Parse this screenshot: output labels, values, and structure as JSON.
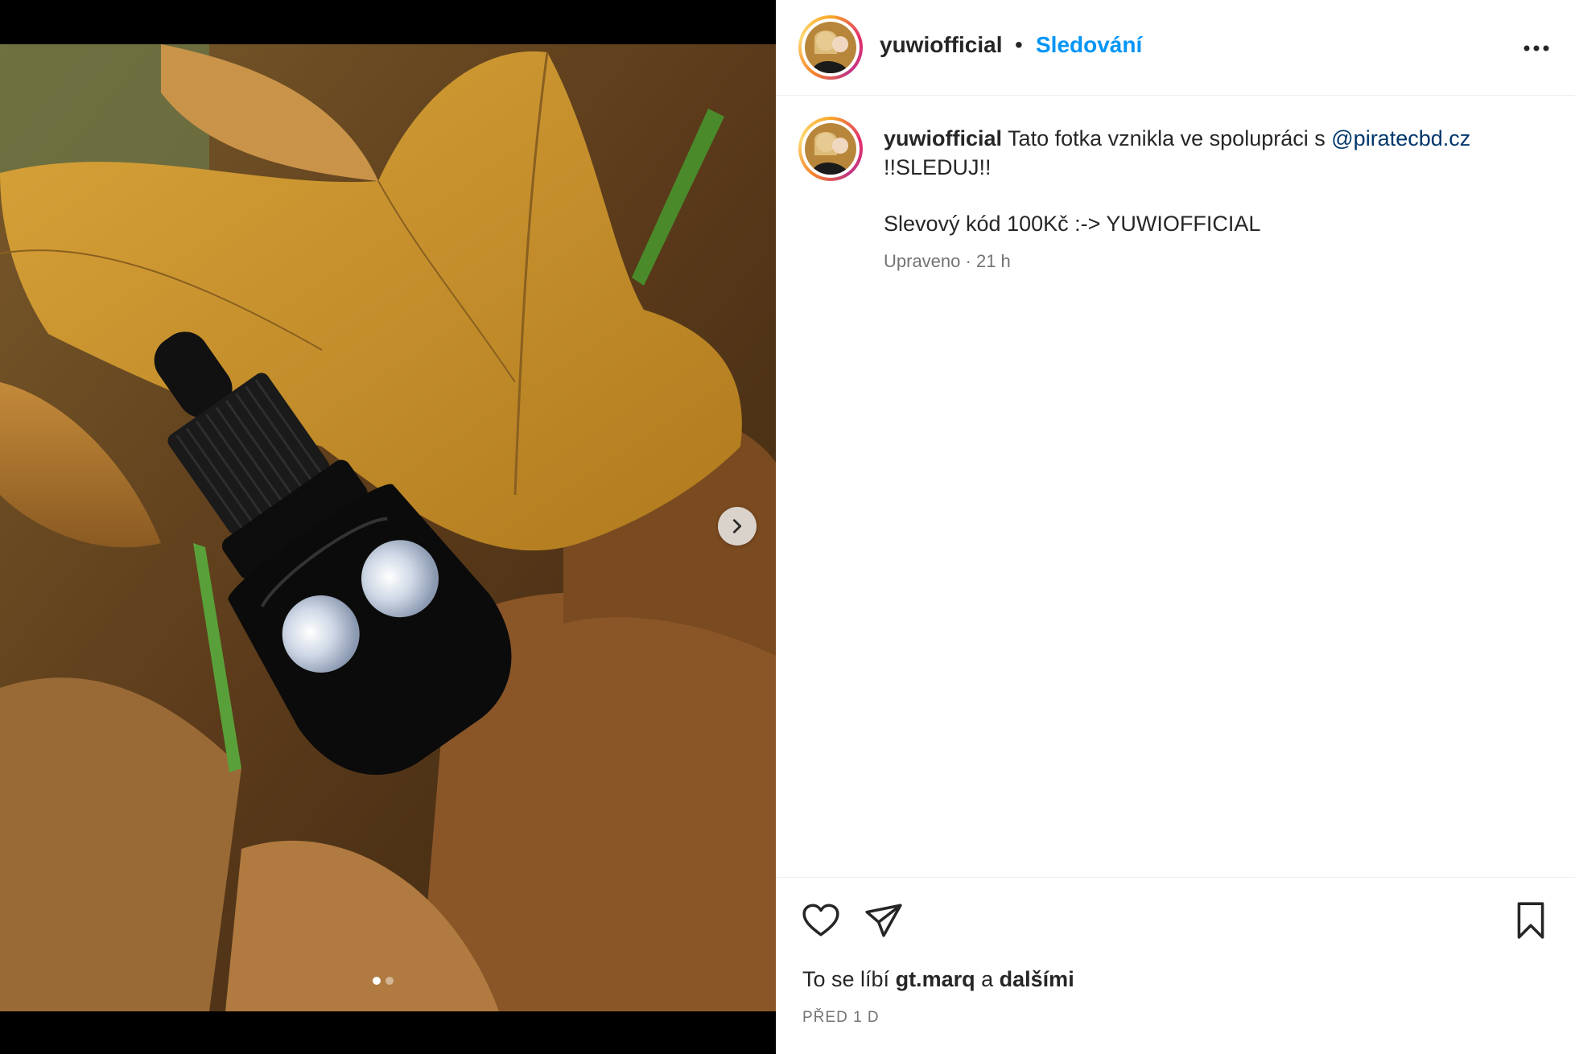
{
  "post": {
    "username": "yuwiofficial",
    "separator": "•",
    "follow_label": "Sledování",
    "more_icon": "more-horizontal-icon"
  },
  "media": {
    "carousel_total": 2,
    "carousel_active": 1,
    "next_icon": "chevron-right-icon"
  },
  "caption": {
    "username": "yuwiofficial",
    "text_before_mention": "Tato fotka vznikla ve spolupráci s",
    "mention": "@piratecbd.cz",
    "line2": "!!SLEDUJ!!",
    "line3": "Slevový kód 100Kč :-> YUWIOFFICIAL",
    "edited": "Upraveno",
    "dot": "·",
    "age": "21 h"
  },
  "actions": {
    "like_icon": "heart-icon",
    "share_icon": "paper-plane-icon",
    "save_icon": "bookmark-icon"
  },
  "likes": {
    "prefix": "To se líbí",
    "user": "gt.marq",
    "conj": "a",
    "others": "dalšími"
  },
  "timestamp": "PŘED 1 D",
  "colors": {
    "link_blue": "#0095f6",
    "mention_blue": "#00376b",
    "muted": "#737373"
  }
}
